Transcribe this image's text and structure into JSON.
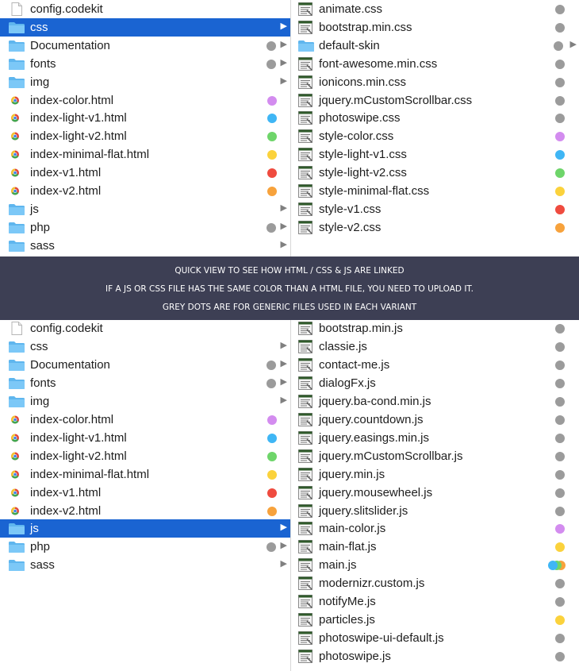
{
  "colors": {
    "grey": "#9b9b9b",
    "purple": "#d38cef",
    "blue": "#3fb6f5",
    "green": "#6ed56a",
    "yellow": "#fbd23c",
    "red": "#ef4b3f",
    "orange": "#f7a23c",
    "selection": "#1a64d2",
    "banner": "#3d3f54"
  },
  "banner": {
    "line1": "QUICK VIEW TO SEE HOW HTML / CSS & JS ARE LINKED",
    "line2": "IF A JS OR CSS FILE HAS THE SAME COLOR THAN A HTML FILE, YOU NEED TO UPLOAD IT.",
    "line3": "GREY DOTS ARE FOR GENERIC FILES USED IN EACH VARIANT"
  },
  "top_left": [
    {
      "name": "config.codekit",
      "icon": "document-icon",
      "tag": null,
      "arrow": false,
      "selected": false
    },
    {
      "name": "css",
      "icon": "folder-icon",
      "tag": null,
      "arrow": true,
      "selected": true
    },
    {
      "name": "Documentation",
      "icon": "folder-icon",
      "tag": "grey",
      "arrow": true,
      "selected": false
    },
    {
      "name": "fonts",
      "icon": "folder-icon",
      "tag": "grey",
      "arrow": true,
      "selected": false
    },
    {
      "name": "img",
      "icon": "folder-icon",
      "tag": null,
      "arrow": true,
      "selected": false
    },
    {
      "name": "index-color.html",
      "icon": "chrome-html-icon",
      "tag": "purple",
      "arrow": false,
      "selected": false
    },
    {
      "name": "index-light-v1.html",
      "icon": "chrome-html-icon",
      "tag": "blue",
      "arrow": false,
      "selected": false
    },
    {
      "name": "index-light-v2.html",
      "icon": "chrome-html-icon",
      "tag": "green",
      "arrow": false,
      "selected": false
    },
    {
      "name": "index-minimal-flat.html",
      "icon": "chrome-html-icon",
      "tag": "yellow",
      "arrow": false,
      "selected": false
    },
    {
      "name": "index-v1.html",
      "icon": "chrome-html-icon",
      "tag": "red",
      "arrow": false,
      "selected": false
    },
    {
      "name": "index-v2.html",
      "icon": "chrome-html-icon",
      "tag": "orange",
      "arrow": false,
      "selected": false
    },
    {
      "name": "js",
      "icon": "folder-icon",
      "tag": null,
      "arrow": true,
      "selected": false
    },
    {
      "name": "php",
      "icon": "folder-icon",
      "tag": "grey",
      "arrow": true,
      "selected": false
    },
    {
      "name": "sass",
      "icon": "folder-icon",
      "tag": null,
      "arrow": true,
      "selected": false
    }
  ],
  "top_right": [
    {
      "name": "animate.css",
      "icon": "code-file-icon",
      "tag": "grey",
      "arrow": false
    },
    {
      "name": "bootstrap.min.css",
      "icon": "code-file-icon",
      "tag": "grey",
      "arrow": false
    },
    {
      "name": "default-skin",
      "icon": "folder-icon",
      "tag": "grey",
      "arrow": true
    },
    {
      "name": "font-awesome.min.css",
      "icon": "code-file-icon",
      "tag": "grey",
      "arrow": false
    },
    {
      "name": "ionicons.min.css",
      "icon": "code-file-icon",
      "tag": "grey",
      "arrow": false
    },
    {
      "name": "jquery.mCustomScrollbar.css",
      "icon": "code-file-icon",
      "tag": "grey",
      "arrow": false
    },
    {
      "name": "photoswipe.css",
      "icon": "code-file-icon",
      "tag": "grey",
      "arrow": false
    },
    {
      "name": "style-color.css",
      "icon": "code-file-icon",
      "tag": "purple",
      "arrow": false
    },
    {
      "name": "style-light-v1.css",
      "icon": "code-file-icon",
      "tag": "blue",
      "arrow": false
    },
    {
      "name": "style-light-v2.css",
      "icon": "code-file-icon",
      "tag": "green",
      "arrow": false
    },
    {
      "name": "style-minimal-flat.css",
      "icon": "code-file-icon",
      "tag": "yellow",
      "arrow": false
    },
    {
      "name": "style-v1.css",
      "icon": "code-file-icon",
      "tag": "red",
      "arrow": false
    },
    {
      "name": "style-v2.css",
      "icon": "code-file-icon",
      "tag": "orange",
      "arrow": false
    }
  ],
  "bottom_left": [
    {
      "name": "config.codekit",
      "icon": "document-icon",
      "tag": null,
      "arrow": false,
      "selected": false
    },
    {
      "name": "css",
      "icon": "folder-icon",
      "tag": null,
      "arrow": true,
      "selected": false
    },
    {
      "name": "Documentation",
      "icon": "folder-icon",
      "tag": "grey",
      "arrow": true,
      "selected": false
    },
    {
      "name": "fonts",
      "icon": "folder-icon",
      "tag": "grey",
      "arrow": true,
      "selected": false
    },
    {
      "name": "img",
      "icon": "folder-icon",
      "tag": null,
      "arrow": true,
      "selected": false
    },
    {
      "name": "index-color.html",
      "icon": "chrome-html-icon",
      "tag": "purple",
      "arrow": false,
      "selected": false
    },
    {
      "name": "index-light-v1.html",
      "icon": "chrome-html-icon",
      "tag": "blue",
      "arrow": false,
      "selected": false
    },
    {
      "name": "index-light-v2.html",
      "icon": "chrome-html-icon",
      "tag": "green",
      "arrow": false,
      "selected": false
    },
    {
      "name": "index-minimal-flat.html",
      "icon": "chrome-html-icon",
      "tag": "yellow",
      "arrow": false,
      "selected": false
    },
    {
      "name": "index-v1.html",
      "icon": "chrome-html-icon",
      "tag": "red",
      "arrow": false,
      "selected": false
    },
    {
      "name": "index-v2.html",
      "icon": "chrome-html-icon",
      "tag": "orange",
      "arrow": false,
      "selected": false
    },
    {
      "name": "js",
      "icon": "folder-icon",
      "tag": null,
      "arrow": true,
      "selected": true
    },
    {
      "name": "php",
      "icon": "folder-icon",
      "tag": "grey",
      "arrow": true,
      "selected": false
    },
    {
      "name": "sass",
      "icon": "folder-icon",
      "tag": null,
      "arrow": true,
      "selected": false
    }
  ],
  "bottom_right": [
    {
      "name": "bootstrap.min.js",
      "icon": "code-file-icon",
      "tag": "grey",
      "arrow": false
    },
    {
      "name": "classie.js",
      "icon": "code-file-icon",
      "tag": "grey",
      "arrow": false
    },
    {
      "name": "contact-me.js",
      "icon": "code-file-icon",
      "tag": "grey",
      "arrow": false
    },
    {
      "name": "dialogFx.js",
      "icon": "code-file-icon",
      "tag": "grey",
      "arrow": false
    },
    {
      "name": "jquery.ba-cond.min.js",
      "icon": "code-file-icon",
      "tag": "grey",
      "arrow": false
    },
    {
      "name": "jquery.countdown.js",
      "icon": "code-file-icon",
      "tag": "grey",
      "arrow": false
    },
    {
      "name": "jquery.easings.min.js",
      "icon": "code-file-icon",
      "tag": "grey",
      "arrow": false
    },
    {
      "name": "jquery.mCustomScrollbar.js",
      "icon": "code-file-icon",
      "tag": "grey",
      "arrow": false
    },
    {
      "name": "jquery.min.js",
      "icon": "code-file-icon",
      "tag": "grey",
      "arrow": false
    },
    {
      "name": "jquery.mousewheel.js",
      "icon": "code-file-icon",
      "tag": "grey",
      "arrow": false
    },
    {
      "name": "jquery.slitslider.js",
      "icon": "code-file-icon",
      "tag": "grey",
      "arrow": false
    },
    {
      "name": "main-color.js",
      "icon": "code-file-icon",
      "tag": "purple",
      "arrow": false
    },
    {
      "name": "main-flat.js",
      "icon": "code-file-icon",
      "tag": "yellow",
      "arrow": false
    },
    {
      "name": "main.js",
      "icon": "code-file-icon",
      "tag": "multi",
      "tags": [
        "blue",
        "green",
        "orange"
      ],
      "arrow": false
    },
    {
      "name": "modernizr.custom.js",
      "icon": "code-file-icon",
      "tag": "grey",
      "arrow": false
    },
    {
      "name": "notifyMe.js",
      "icon": "code-file-icon",
      "tag": "grey",
      "arrow": false
    },
    {
      "name": "particles.js",
      "icon": "code-file-icon",
      "tag": "yellow",
      "arrow": false
    },
    {
      "name": "photoswipe-ui-default.js",
      "icon": "code-file-icon",
      "tag": "grey",
      "arrow": false
    },
    {
      "name": "photoswipe.js",
      "icon": "code-file-icon",
      "tag": "grey",
      "arrow": false
    }
  ]
}
